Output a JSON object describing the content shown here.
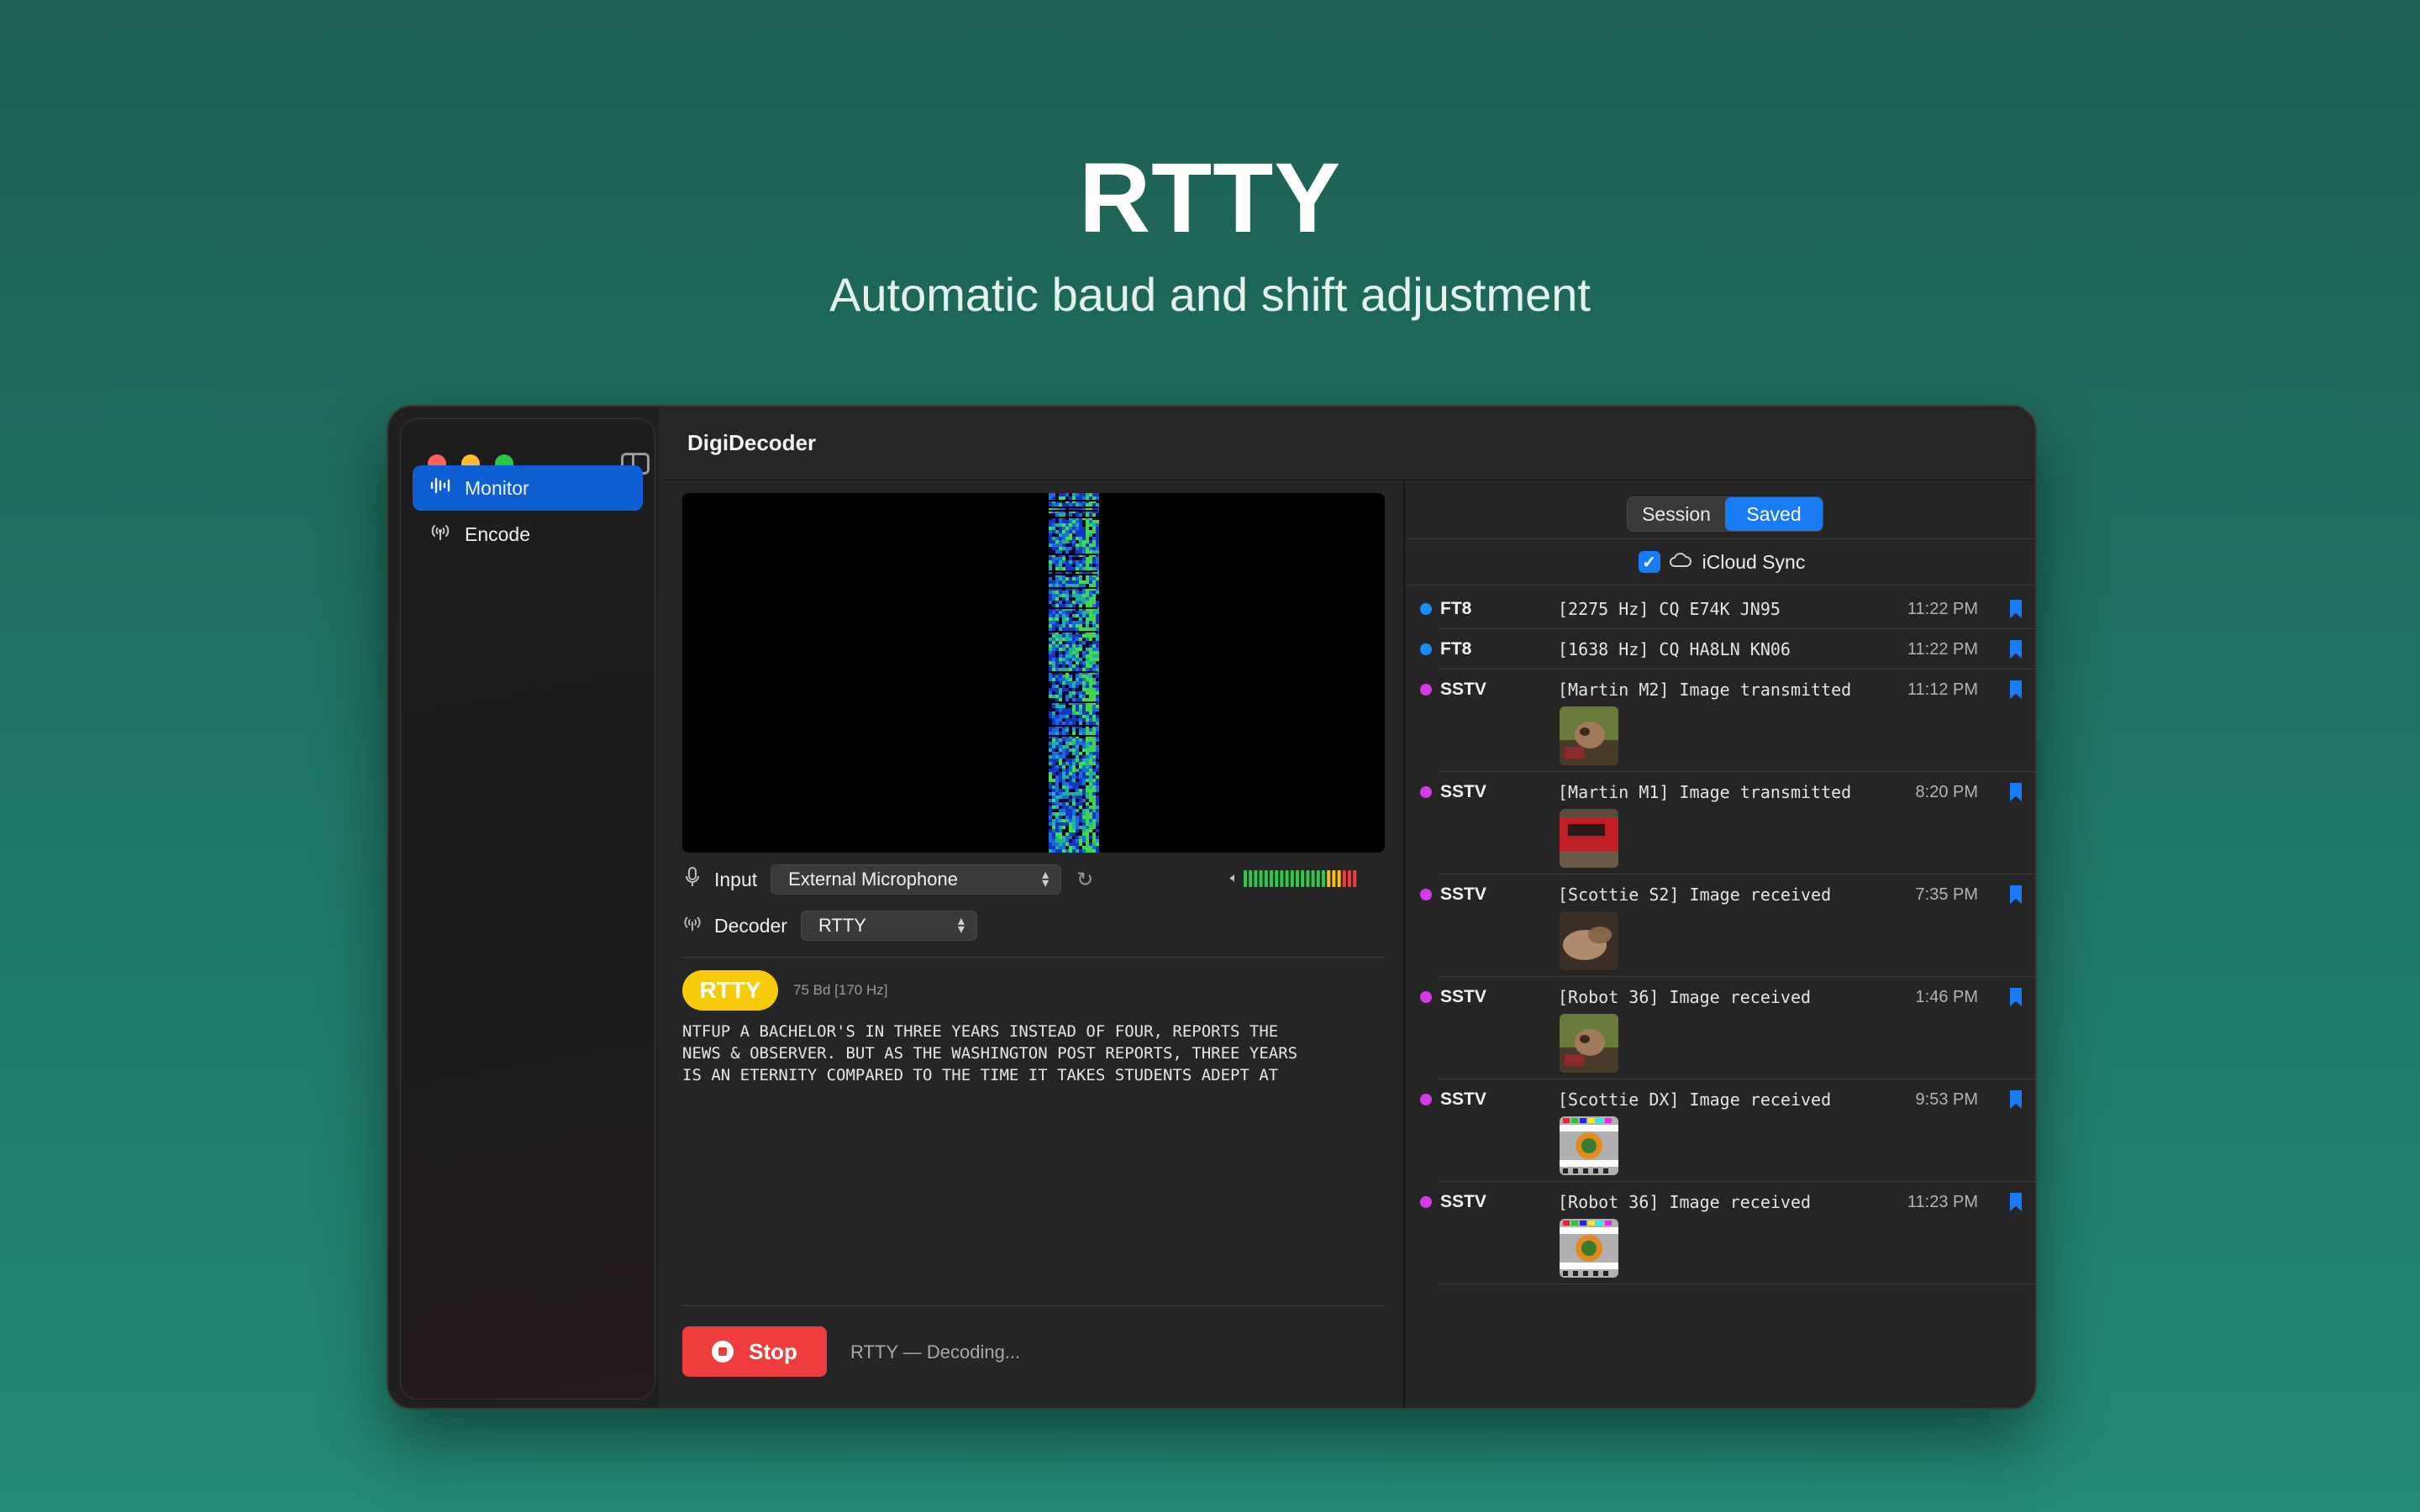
{
  "hero": {
    "title": "RTTY",
    "subtitle": "Automatic baud and shift adjustment"
  },
  "window": {
    "app_title": "DigiDecoder"
  },
  "sidebar": {
    "items": [
      {
        "label": "Monitor",
        "icon": "waveform-icon",
        "active": true
      },
      {
        "label": "Encode",
        "icon": "antenna-icon",
        "active": false
      }
    ]
  },
  "controls": {
    "input_label": "Input",
    "input_value": "External Microphone",
    "decoder_label": "Decoder",
    "decoder_value": "RTTY",
    "level_segments": 22
  },
  "decoder_output": {
    "mode_badge": "RTTY",
    "badge_color": "#f6cc0a",
    "info": "75 Bd [170 Hz]",
    "text": "NTFUP A BACHELOR'S IN THREE YEARS INSTEAD OF FOUR, REPORTS THE\nNEWS & OBSERVER. BUT AS THE WASHINGTON POST REPORTS, THREE YEARS\nIS AN ETERNITY COMPARED TO THE TIME IT TAKES STUDENTS ADEPT AT"
  },
  "footer": {
    "stop_label": "Stop",
    "status": "RTTY — Decoding..."
  },
  "log": {
    "tabs": [
      "Session",
      "Saved"
    ],
    "active_tab": "Saved",
    "icloud_sync_label": "iCloud Sync",
    "icloud_sync_checked": true,
    "entries": [
      {
        "mode": "FT8",
        "message": "[2275 Hz] CQ E74K JN95",
        "time": "11:22 PM",
        "color": "#1a8cff",
        "thumb": null
      },
      {
        "mode": "FT8",
        "message": "[1638 Hz] CQ HA8LN KN06",
        "time": "11:22 PM",
        "color": "#1a8cff",
        "thumb": null
      },
      {
        "mode": "SSTV",
        "message": "[Martin M2] Image transmitted",
        "time": "11:12 PM",
        "color": "#d43be6",
        "thumb": "dog"
      },
      {
        "mode": "SSTV",
        "message": "[Martin M1] Image transmitted",
        "time": "8:20 PM",
        "color": "#d43be6",
        "thumb": "car"
      },
      {
        "mode": "SSTV",
        "message": "[Scottie S2] Image received",
        "time": "7:35 PM",
        "color": "#d43be6",
        "thumb": "hands"
      },
      {
        "mode": "SSTV",
        "message": "[Robot 36] Image received",
        "time": "1:46 PM",
        "color": "#d43be6",
        "thumb": "dog"
      },
      {
        "mode": "SSTV",
        "message": "[Scottie DX] Image received",
        "time": "9:53 PM",
        "color": "#d43be6",
        "thumb": "testcard"
      },
      {
        "mode": "SSTV",
        "message": "[Robot 36] Image received",
        "time": "11:23 PM",
        "color": "#d43be6",
        "thumb": "testcard"
      }
    ]
  }
}
